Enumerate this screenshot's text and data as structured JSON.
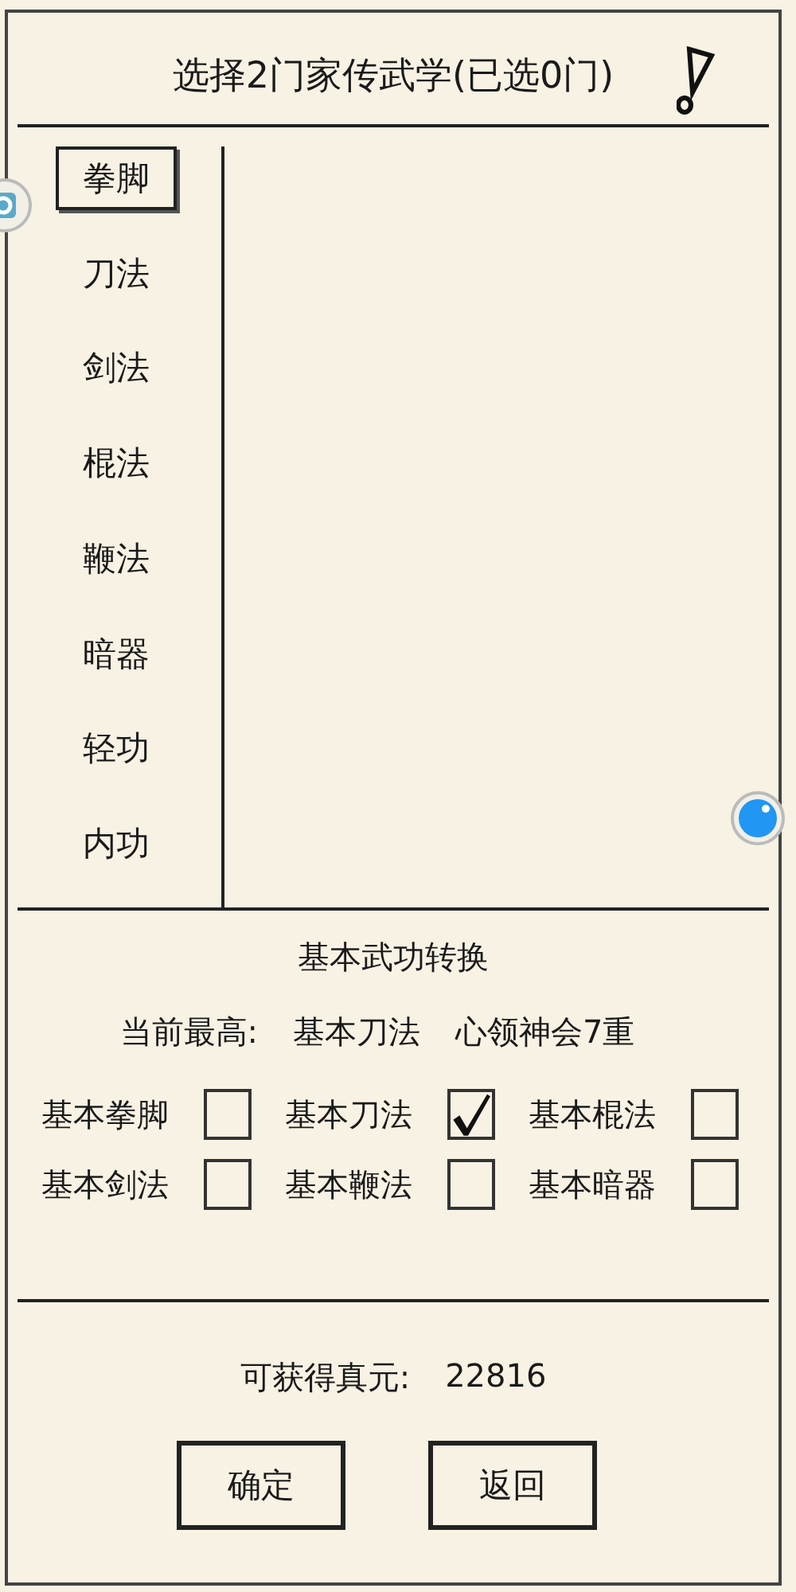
{
  "title": "选择2门家传武学(已选0门)",
  "categories": [
    {
      "label": "拳脚",
      "selected": true
    },
    {
      "label": "刀法",
      "selected": false
    },
    {
      "label": "剑法",
      "selected": false
    },
    {
      "label": "棍法",
      "selected": false
    },
    {
      "label": "鞭法",
      "selected": false
    },
    {
      "label": "暗器",
      "selected": false
    },
    {
      "label": "轻功",
      "selected": false
    },
    {
      "label": "内功",
      "selected": false
    }
  ],
  "conversion": {
    "heading": "基本武功转换",
    "current_label": "当前最高:",
    "current_skill": "基本刀法",
    "current_level": "心领神会7重",
    "options": [
      {
        "label": "基本拳脚",
        "checked": false
      },
      {
        "label": "基本刀法",
        "checked": true
      },
      {
        "label": "基本棍法",
        "checked": false
      },
      {
        "label": "基本剑法",
        "checked": false
      },
      {
        "label": "基本鞭法",
        "checked": false
      },
      {
        "label": "基本暗器",
        "checked": false
      }
    ]
  },
  "reward": {
    "label": "可获得真元:",
    "value": "22816"
  },
  "buttons": [
    "确定",
    "返回"
  ]
}
